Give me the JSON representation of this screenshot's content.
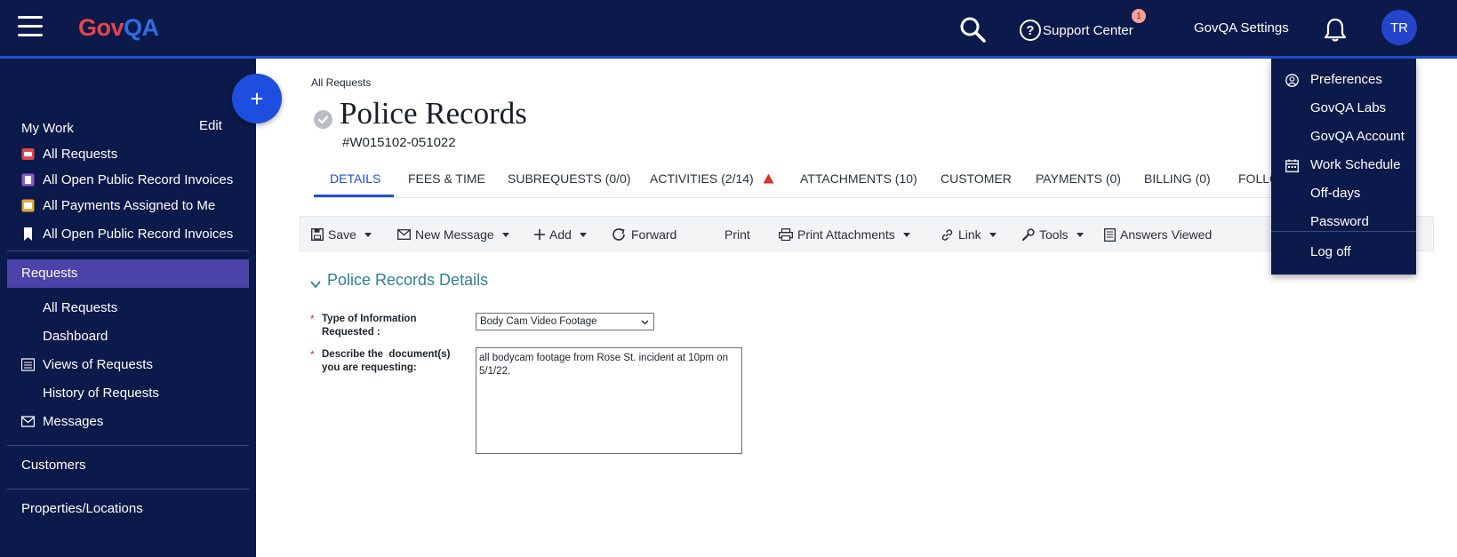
{
  "brand": {
    "logo_gov": "Gov",
    "logo_qa": "QA"
  },
  "topbar": {
    "support_label": "Support Center",
    "support_badge": "1",
    "settings_label": "GovQA Settings",
    "avatar_initials": "TR"
  },
  "sidebar": {
    "fab_label": "+",
    "my_work_label": "My Work",
    "edit_label": "Edit",
    "my_work_items": [
      {
        "label": "All Requests",
        "icon": "inbox-icon"
      },
      {
        "label": "All Open Public Record Invoices",
        "icon": "invoice-icon"
      },
      {
        "label": "All Payments Assigned to Me",
        "icon": "payment-icon"
      },
      {
        "label": "All Open Public Record Invoices",
        "icon": "bookmark-icon"
      }
    ],
    "requests_label": "Requests",
    "requests_items": [
      {
        "label": "All Requests"
      },
      {
        "label": "Dashboard"
      },
      {
        "label": "Views of Requests",
        "icon": "list-icon"
      },
      {
        "label": "History of Requests"
      },
      {
        "label": "Messages",
        "icon": "mail-icon"
      }
    ],
    "customers_label": "Customers",
    "properties_label": "Properties/Locations"
  },
  "main": {
    "breadcrumb": "All Requests",
    "title": "Police Records",
    "request_number": "#W015102-051022",
    "tabs": [
      {
        "label": "DETAILS",
        "active": true
      },
      {
        "label": "FEES & TIME"
      },
      {
        "label": "SUBREQUESTS (0/0)"
      },
      {
        "label": "ACTIVITIES (2/14)",
        "warning": true
      },
      {
        "label": "ATTACHMENTS (10)"
      },
      {
        "label": "CUSTOMER"
      },
      {
        "label": "PAYMENTS (0)"
      },
      {
        "label": "BILLING (0)"
      },
      {
        "label": "FOLLO"
      }
    ],
    "toolbar": {
      "save": "Save",
      "new_message": "New Message",
      "add": "Add",
      "forward": "Forward",
      "print": "Print",
      "print_attachments": "Print Attachments",
      "link": "Link",
      "tools": "Tools",
      "answers_viewed": "Answers Viewed"
    },
    "section_title": "Police Records Details",
    "fields": {
      "type_label_line1": "Type of Information",
      "type_label_line2": "Requested :",
      "type_value": "Body Cam Video Footage",
      "describe_label_line1": "Describe the  document(s)",
      "describe_label_line2": "you are requesting:",
      "describe_value": "all bodycam footage from Rose St. incident at 10pm on 5/1/22.",
      "required_mark": "*"
    }
  },
  "user_menu": {
    "items": [
      {
        "label": "Preferences",
        "icon": "user-circle-icon"
      },
      {
        "label": "GovQA Labs"
      },
      {
        "label": "GovQA Account"
      },
      {
        "label": "Work Schedule",
        "icon": "calendar-icon"
      },
      {
        "label": "Off-days"
      },
      {
        "label": "Password"
      }
    ],
    "logoff": "Log off"
  },
  "colors": {
    "navy": "#0b1a4a",
    "accent_blue": "#1e4fd1",
    "active_purple": "#4b43a8",
    "logo_red": "#e8434b",
    "section_teal": "#2e8097"
  }
}
